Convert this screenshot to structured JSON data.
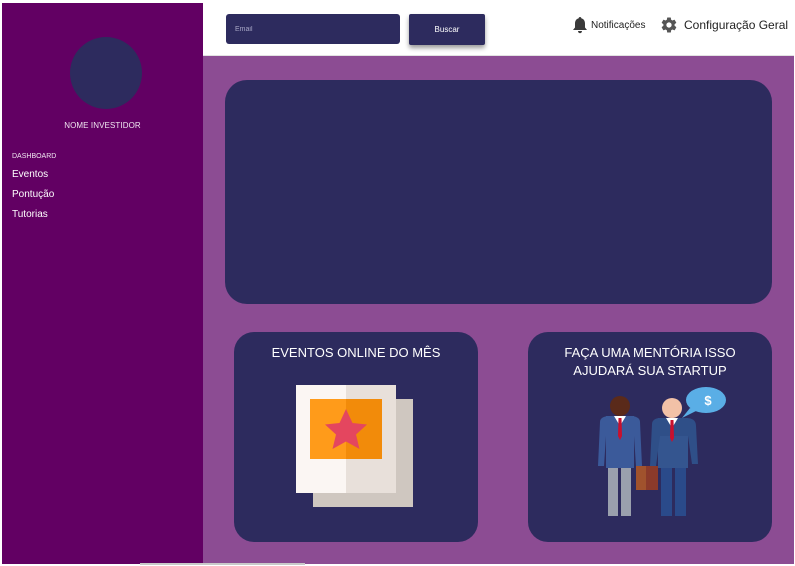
{
  "sidebar": {
    "investor_name": "NOME INVESTIDOR",
    "section_label": "DASHBOARD",
    "items": [
      {
        "label": "Eventos"
      },
      {
        "label": "Pontução"
      },
      {
        "label": "Tutorias"
      }
    ]
  },
  "topbar": {
    "search_placeholder": "Email",
    "search_button": "Buscar",
    "notifications_label": "Notificações",
    "settings_label": "Configuração Geral"
  },
  "cards": [
    {
      "title": "EVENTOS ONLINE DO MÊS",
      "icon": "photo-star-icon"
    },
    {
      "title": "FAÇA UMA MENTÓRIA ISSO AJUDARÁ SUA STARTUP",
      "icon": "mentors-icon"
    }
  ],
  "speech_bubble": {
    "symbol": "$"
  },
  "colors": {
    "sidebar": "#620063",
    "main_background": "#8c4c93",
    "panel": "#2d2b5e"
  }
}
